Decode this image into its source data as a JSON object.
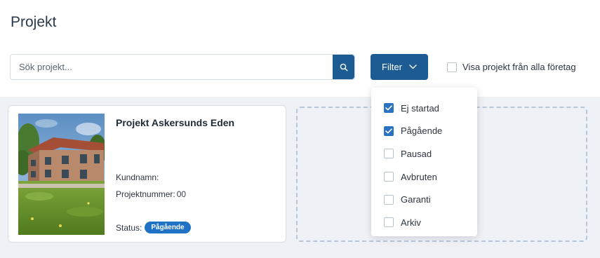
{
  "page": {
    "title": "Projekt"
  },
  "search": {
    "placeholder": "Sök projekt...",
    "value": ""
  },
  "filter": {
    "label": "Filter",
    "options": [
      {
        "label": "Ej startad",
        "checked": true
      },
      {
        "label": "Pågående",
        "checked": true
      },
      {
        "label": "Pausad",
        "checked": false
      },
      {
        "label": "Avbruten",
        "checked": false
      },
      {
        "label": "Garanti",
        "checked": false
      },
      {
        "label": "Arkiv",
        "checked": false
      }
    ]
  },
  "all_companies": {
    "label": "Visa projekt från alla företag",
    "checked": false
  },
  "project_card": {
    "title": "Projekt Askersunds Eden",
    "customer_label": "Kundnamn:",
    "customer_value": "",
    "number_label": "Projektnummer:",
    "number_value": "00",
    "status_label": "Status:",
    "status_value": "Pågående"
  },
  "colors": {
    "primary": "#1d5c92",
    "badge": "#1f72c4",
    "checkbox_checked": "#2a73c0",
    "background": "#eef1f5"
  },
  "icons": {
    "search": "search-icon",
    "chevron": "chevron-down-icon",
    "check": "check-icon"
  }
}
